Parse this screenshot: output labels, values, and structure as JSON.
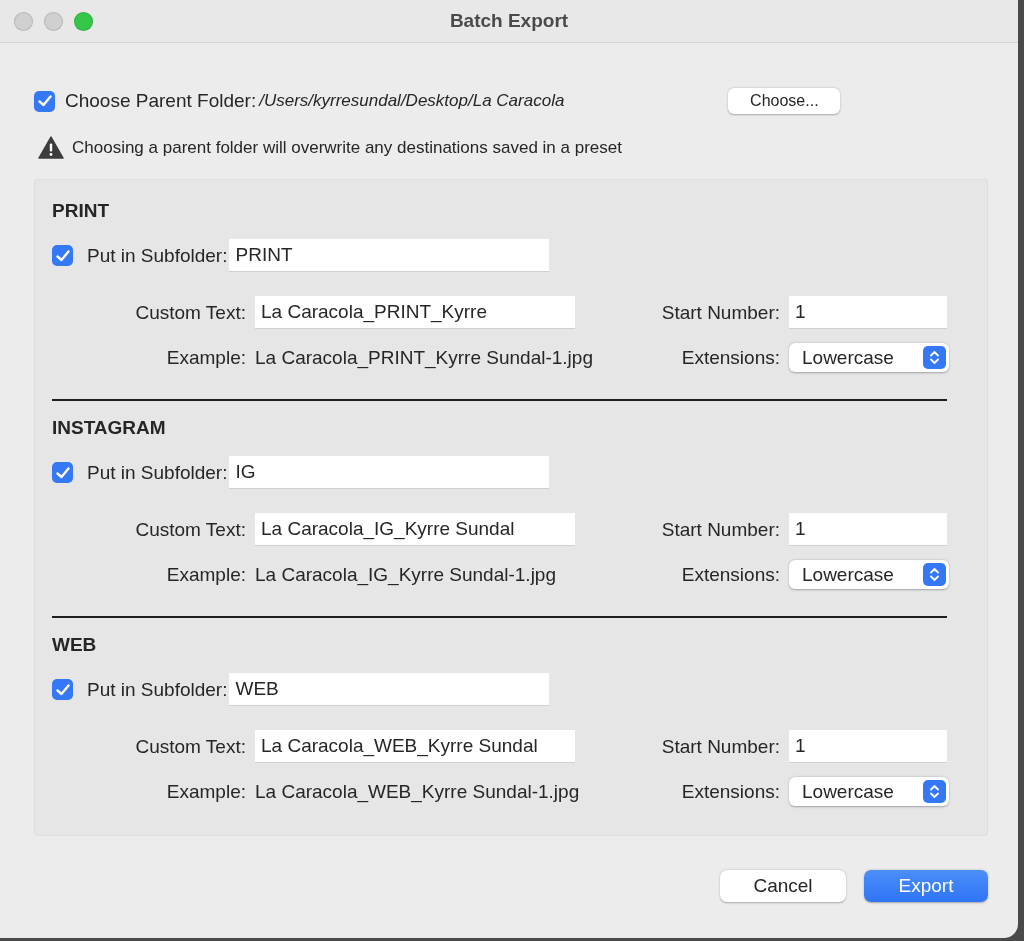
{
  "window": {
    "title": "Batch Export"
  },
  "parent_folder": {
    "checked": true,
    "label": "Choose Parent Folder:",
    "path": "/Users/kyrresundal/Desktop/La Caracola",
    "button": "Choose..."
  },
  "warning": "Choosing a parent folder will overwrite any destinations saved in a preset",
  "sections": [
    {
      "title": "PRINT",
      "subfolder": {
        "checked": true,
        "label": "Put in Subfolder:",
        "value": "PRINT"
      },
      "custom_text": {
        "label": "Custom Text:",
        "value": "La Caracola_PRINT_Kyrre"
      },
      "start_number": {
        "label": "Start Number:",
        "value": "1"
      },
      "example": {
        "label": "Example:",
        "value": "La Caracola_PRINT_Kyrre Sundal-1.jpg"
      },
      "extensions": {
        "label": "Extensions:",
        "value": "Lowercase"
      }
    },
    {
      "title": "INSTAGRAM",
      "subfolder": {
        "checked": true,
        "label": "Put in Subfolder:",
        "value": "IG"
      },
      "custom_text": {
        "label": "Custom Text:",
        "value": "La Caracola_IG_Kyrre Sundal"
      },
      "start_number": {
        "label": "Start Number:",
        "value": "1"
      },
      "example": {
        "label": "Example:",
        "value": "La Caracola_IG_Kyrre Sundal-1.jpg"
      },
      "extensions": {
        "label": "Extensions:",
        "value": "Lowercase"
      }
    },
    {
      "title": "WEB",
      "subfolder": {
        "checked": true,
        "label": "Put in Subfolder:",
        "value": "WEB"
      },
      "custom_text": {
        "label": "Custom Text:",
        "value": "La Caracola_WEB_Kyrre Sundal"
      },
      "start_number": {
        "label": "Start Number:",
        "value": "1"
      },
      "example": {
        "label": "Example:",
        "value": "La Caracola_WEB_Kyrre Sundal-1.jpg"
      },
      "extensions": {
        "label": "Extensions:",
        "value": "Lowercase"
      }
    }
  ],
  "buttons": [
    {
      "label": "Cancel",
      "kind": "secondary"
    },
    {
      "label": "Export",
      "kind": "primary"
    }
  ]
}
